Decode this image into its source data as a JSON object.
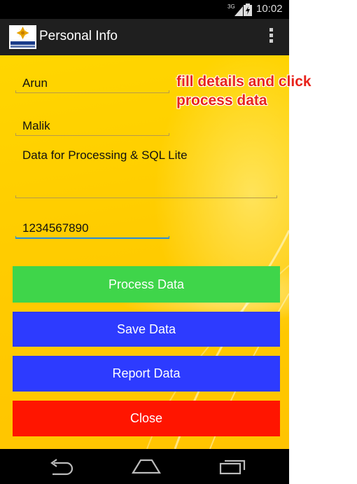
{
  "status_bar": {
    "network": "3G",
    "time": "10:02"
  },
  "action_bar": {
    "logo": "sjsu-logo",
    "title": "Personal Info",
    "menu_icon": "overflow-menu-icon"
  },
  "form": {
    "first_name": "Arun",
    "last_name": "Malik",
    "description": "Data for Processing & SQL Lite",
    "phone": "1234567890"
  },
  "buttons": {
    "process": "Process Data",
    "save": "Save Data",
    "report": "Report Data",
    "close": "Close"
  },
  "colors": {
    "process": "#3fd54a",
    "save": "#2d3bff",
    "report": "#2d3bff",
    "close": "#ff1500",
    "annotation": "#e8231c"
  },
  "annotation": {
    "line1": "fill details and click",
    "line2": "process data"
  },
  "nav": {
    "back": "back-icon",
    "home": "home-icon",
    "recents": "recents-icon"
  }
}
